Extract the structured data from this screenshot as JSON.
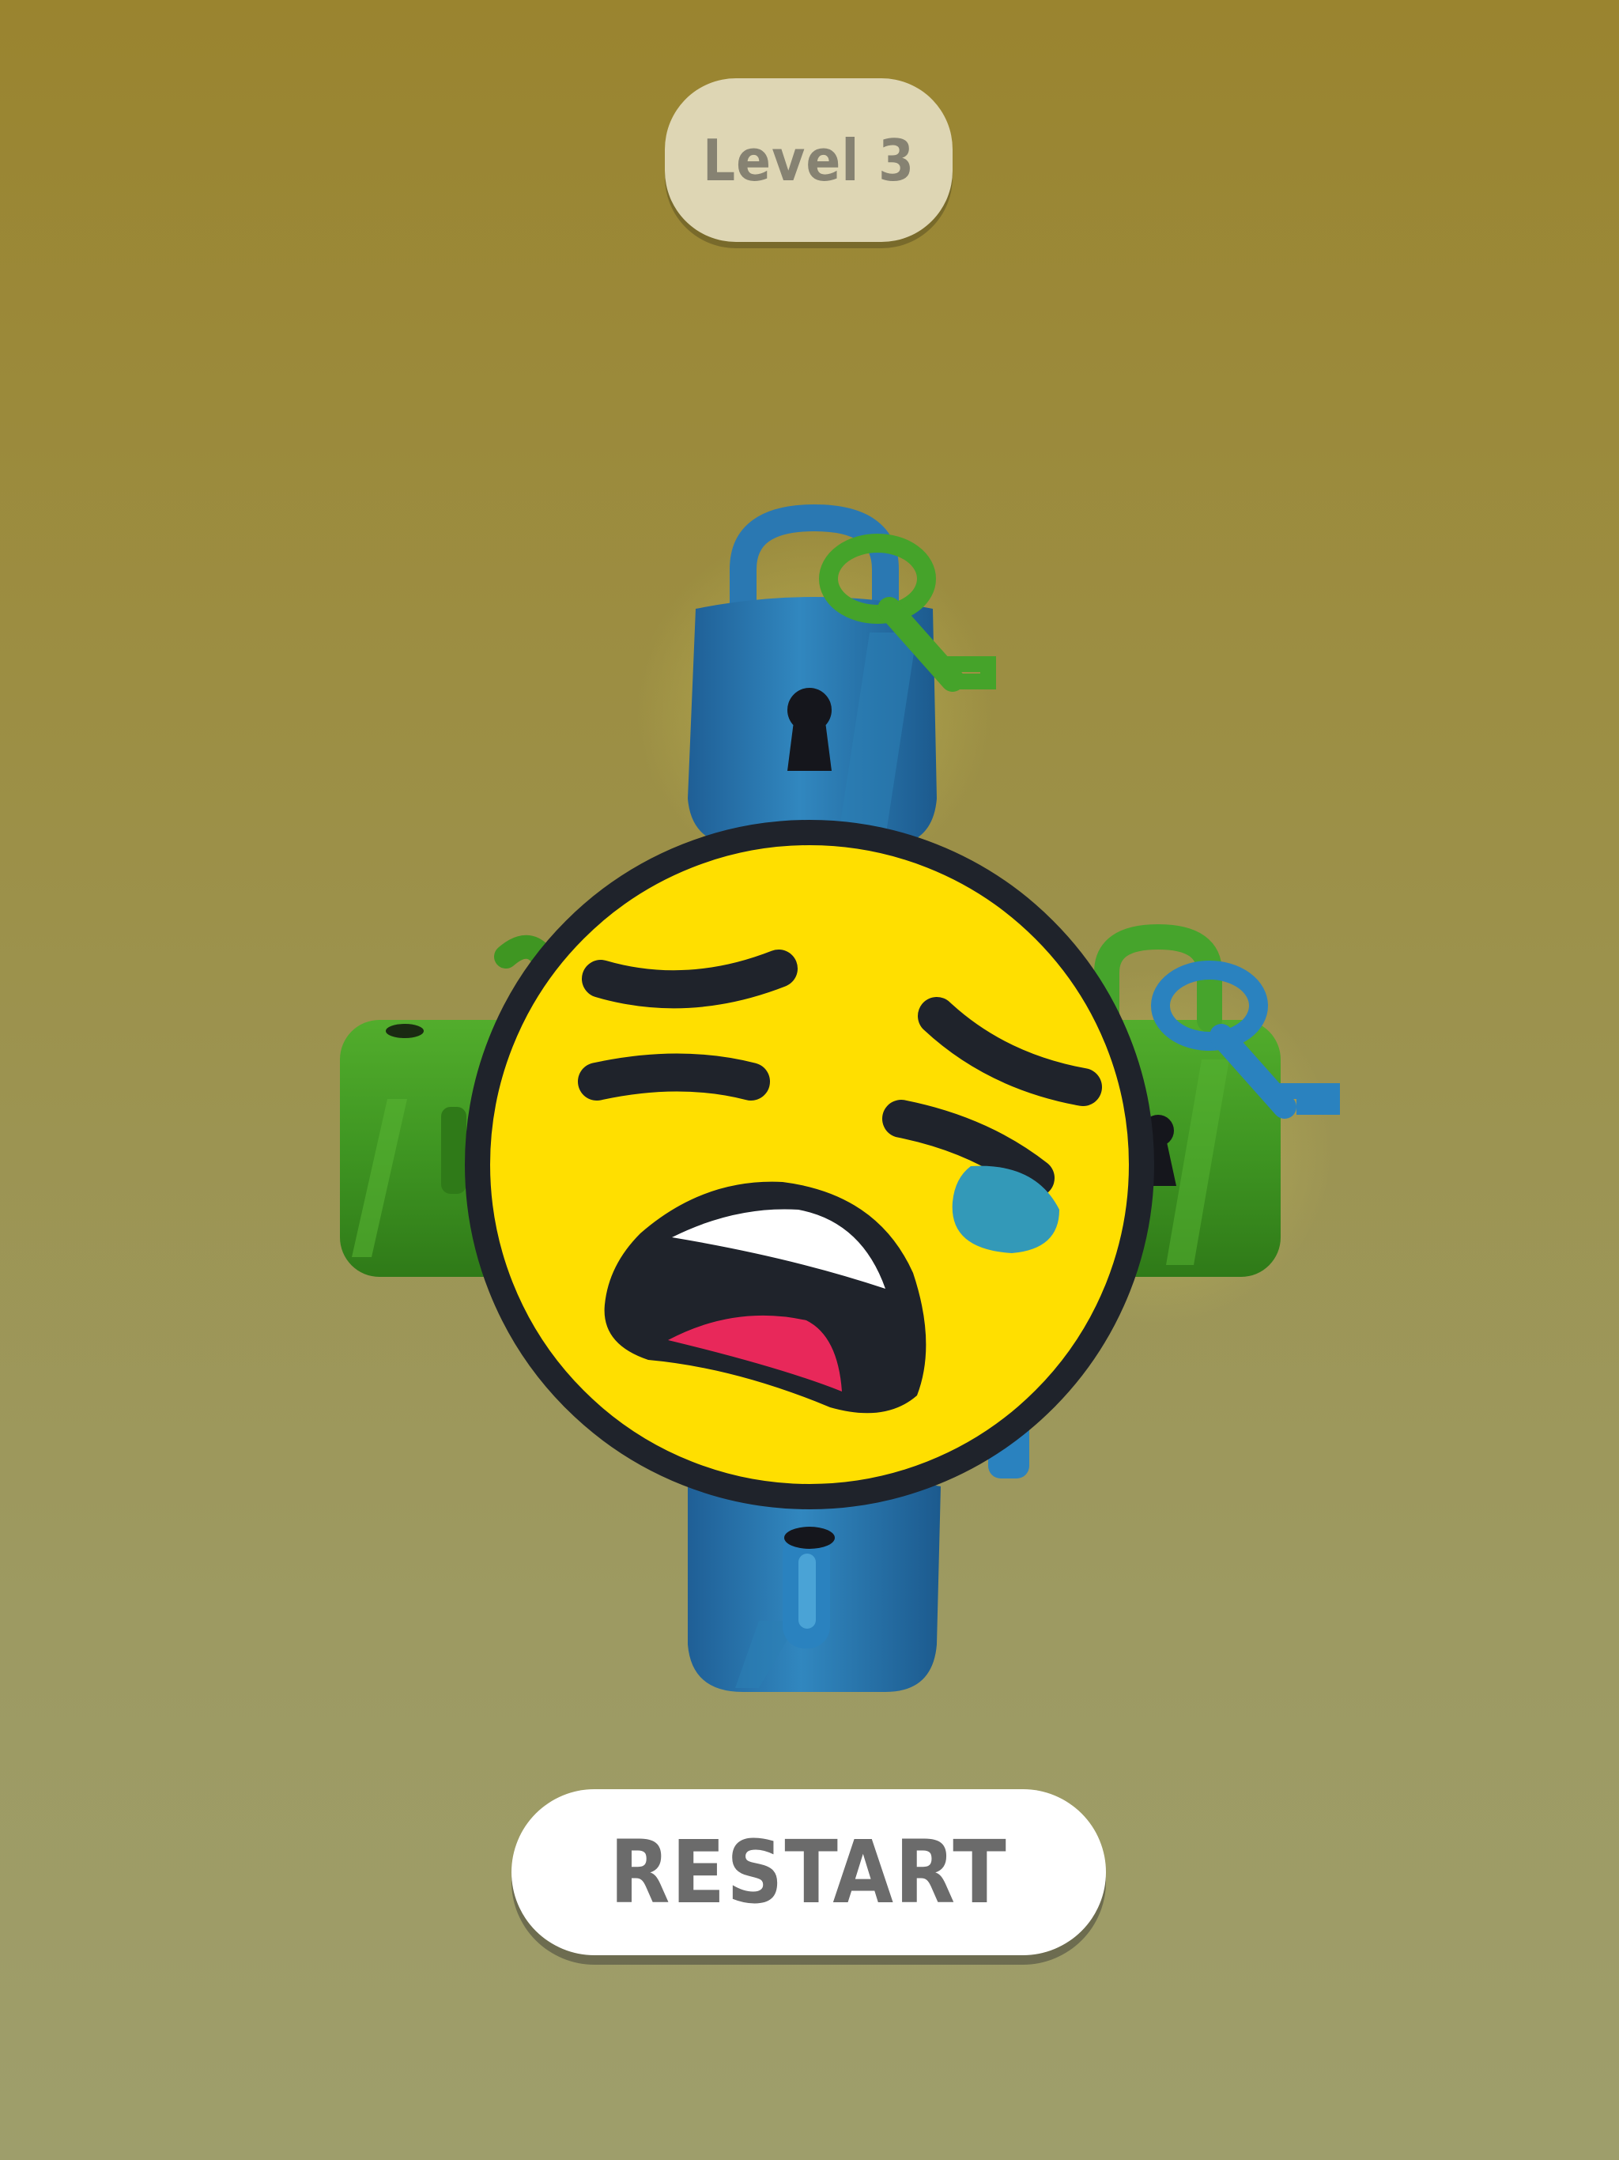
{
  "hud": {
    "level_label": "Level 3"
  },
  "actions": {
    "restart_label": "RESTART"
  },
  "colors": {
    "lock_blue": "#2f7fb7",
    "lock_green": "#3f9a2a",
    "emoji_yellow": "#ffdf00",
    "emoji_outline": "#1f232b",
    "tear_blue": "#3399b8",
    "tongue_pink": "#e8285a"
  },
  "icons": {
    "top_lock": "blue-padlock-icon",
    "bottom_lock": "blue-padlock-icon",
    "left_lock": "green-padlock-icon",
    "right_lock": "green-padlock-icon",
    "green_key": "green-key-icon",
    "blue_key": "blue-key-icon",
    "fail_face": "crying-face-icon"
  }
}
